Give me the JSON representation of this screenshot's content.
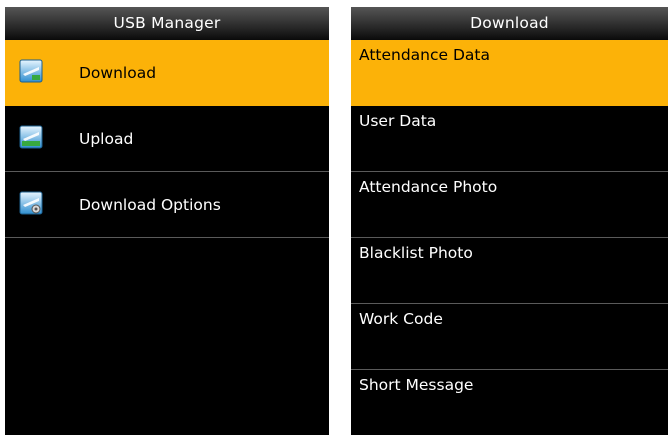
{
  "left_screen": {
    "title": "USB Manager",
    "items": [
      {
        "label": "Download",
        "icon": "download-icon",
        "selected": true
      },
      {
        "label": "Upload",
        "icon": "upload-icon",
        "selected": false
      },
      {
        "label": "Download Options",
        "icon": "download-options-icon",
        "selected": false
      }
    ]
  },
  "right_screen": {
    "title": "Download",
    "items": [
      {
        "label": "Attendance Data",
        "selected": true
      },
      {
        "label": "User Data",
        "selected": false
      },
      {
        "label": "Attendance Photo",
        "selected": false
      },
      {
        "label": "Blacklist Photo",
        "selected": false
      },
      {
        "label": "Work Code",
        "selected": false
      },
      {
        "label": "Short Message",
        "selected": false
      }
    ]
  },
  "colors": {
    "highlight": "#fcb208",
    "background": "#000000",
    "text": "#ffffff",
    "divider": "#5a5a5a"
  }
}
